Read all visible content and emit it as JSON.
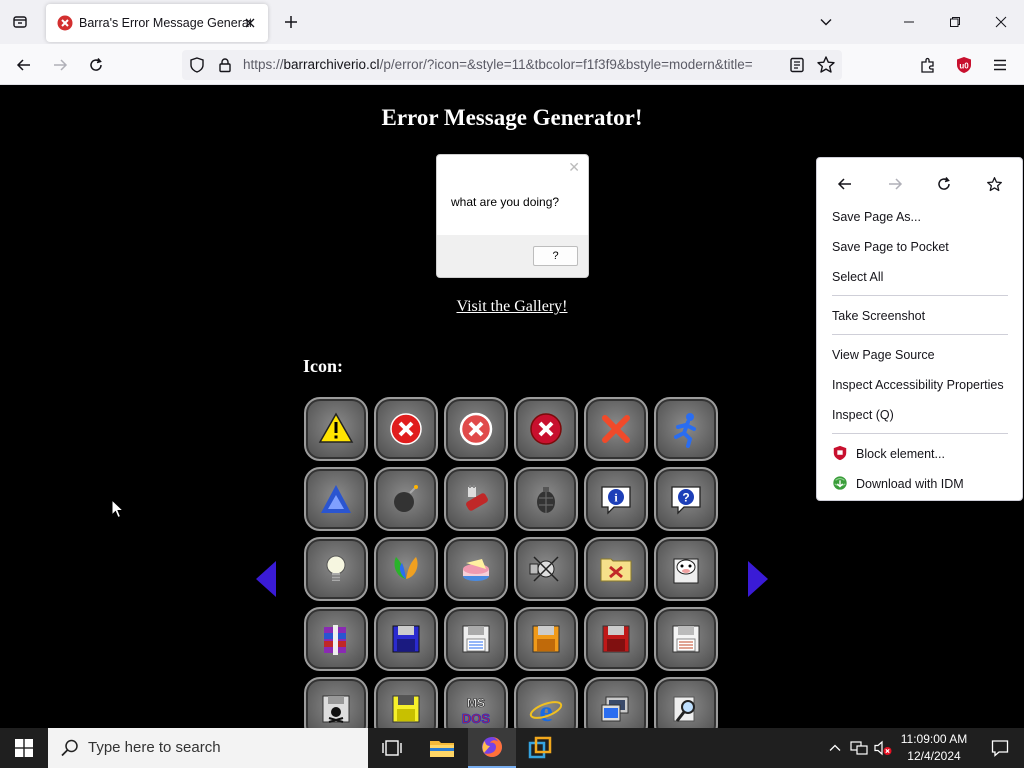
{
  "browser": {
    "tab": {
      "title": "Barra's Error Message Generator"
    },
    "url": {
      "prefix": "https://",
      "host": "barrarchiverio.cl",
      "path": "/p/error/?icon=&style=11&tbcolor=f1f3f9&bstyle=modern&title="
    }
  },
  "page": {
    "title": "Error Message Generator!",
    "dialog": {
      "message": "what are you doing?",
      "button_label": "?"
    },
    "gallery_link": "Visit the Gallery!",
    "icon_label": "Icon:",
    "icons": [
      "warning-icon",
      "error-red-x-icon",
      "error-white-x-icon",
      "error-x-dark-icon",
      "red-x-icon",
      "running-man-icon",
      "blue-triangle-icon",
      "bomb-icon",
      "plug-icon",
      "grenade-icon",
      "info-bubble-icon",
      "question-bubble-icon",
      "lightbulb-icon",
      "msn-butterfly-icon",
      "cake-icon",
      "satellite-icon",
      "folder-tools-icon",
      "cow-icon",
      "winrar-icon",
      "floppy-blue-icon",
      "floppy-white-icon",
      "floppy-orange-icon",
      "floppy-red-icon",
      "floppy-white-2-icon",
      "floppy-skull-icon",
      "floppy-yellow-icon",
      "msdos-icon",
      "internet-explorer-icon",
      "computer-icon",
      "magnifier-icon"
    ]
  },
  "context_menu": {
    "items": [
      {
        "label": "Save Page As..."
      },
      {
        "label": "Save Page to Pocket"
      },
      {
        "label": "Select All"
      },
      {
        "label": "Take Screenshot"
      },
      {
        "label": "View Page Source"
      },
      {
        "label": "Inspect Accessibility Properties"
      },
      {
        "label": "Inspect (Q)"
      },
      {
        "label": "Block element..."
      },
      {
        "label": "Download with IDM"
      }
    ]
  },
  "taskbar": {
    "search_placeholder": "Type here to search",
    "time": "11:09:00 AM",
    "date": "12/4/2024"
  },
  "colors": {
    "page_bg": "#000000",
    "arrow": "#3a1bd6",
    "ublock_red": "#c8102e"
  }
}
